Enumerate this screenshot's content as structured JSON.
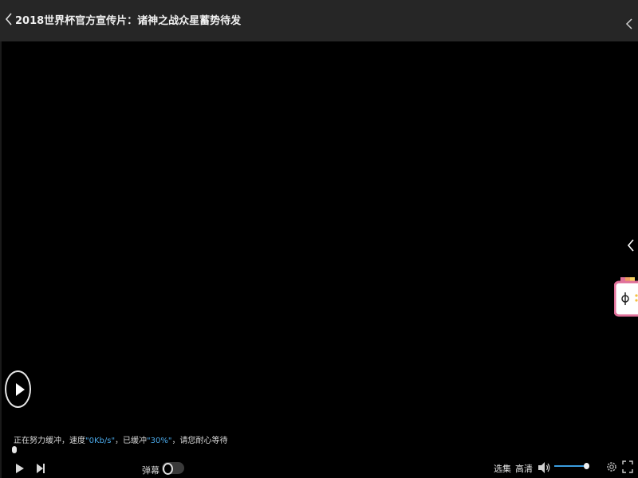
{
  "header": {
    "title": "2018世界杯官方宣传片：诸神之战众星蓄势待发"
  },
  "icons": {
    "back": "chevron-left-icon",
    "top_right": "chevron-left-icon",
    "side_panel": "chevron-left-icon",
    "play": "play-icon",
    "next": "next-icon",
    "volume": "volume-icon",
    "settings": "gear-icon",
    "fullscreen": "fullscreen-icon"
  },
  "buffering": {
    "prefix": "正在努力缓冲，速度",
    "speed": "\"0Kb/s\"",
    "middle": "，已缓冲",
    "percent": "\"30%\"",
    "suffix": "，请您耐心等待"
  },
  "playback": {
    "progress_fraction": 0
  },
  "controls": {
    "danmu_label": "弹幕",
    "danmu_on": false,
    "select_episode_label": "选集",
    "quality_label": "高清",
    "volume_fraction": 1.0
  },
  "colors": {
    "accent": "#3b9de0",
    "highlight_text": "#4aa8e8",
    "topbar_bg": "#262626",
    "widget_pink": "#e0709a"
  }
}
